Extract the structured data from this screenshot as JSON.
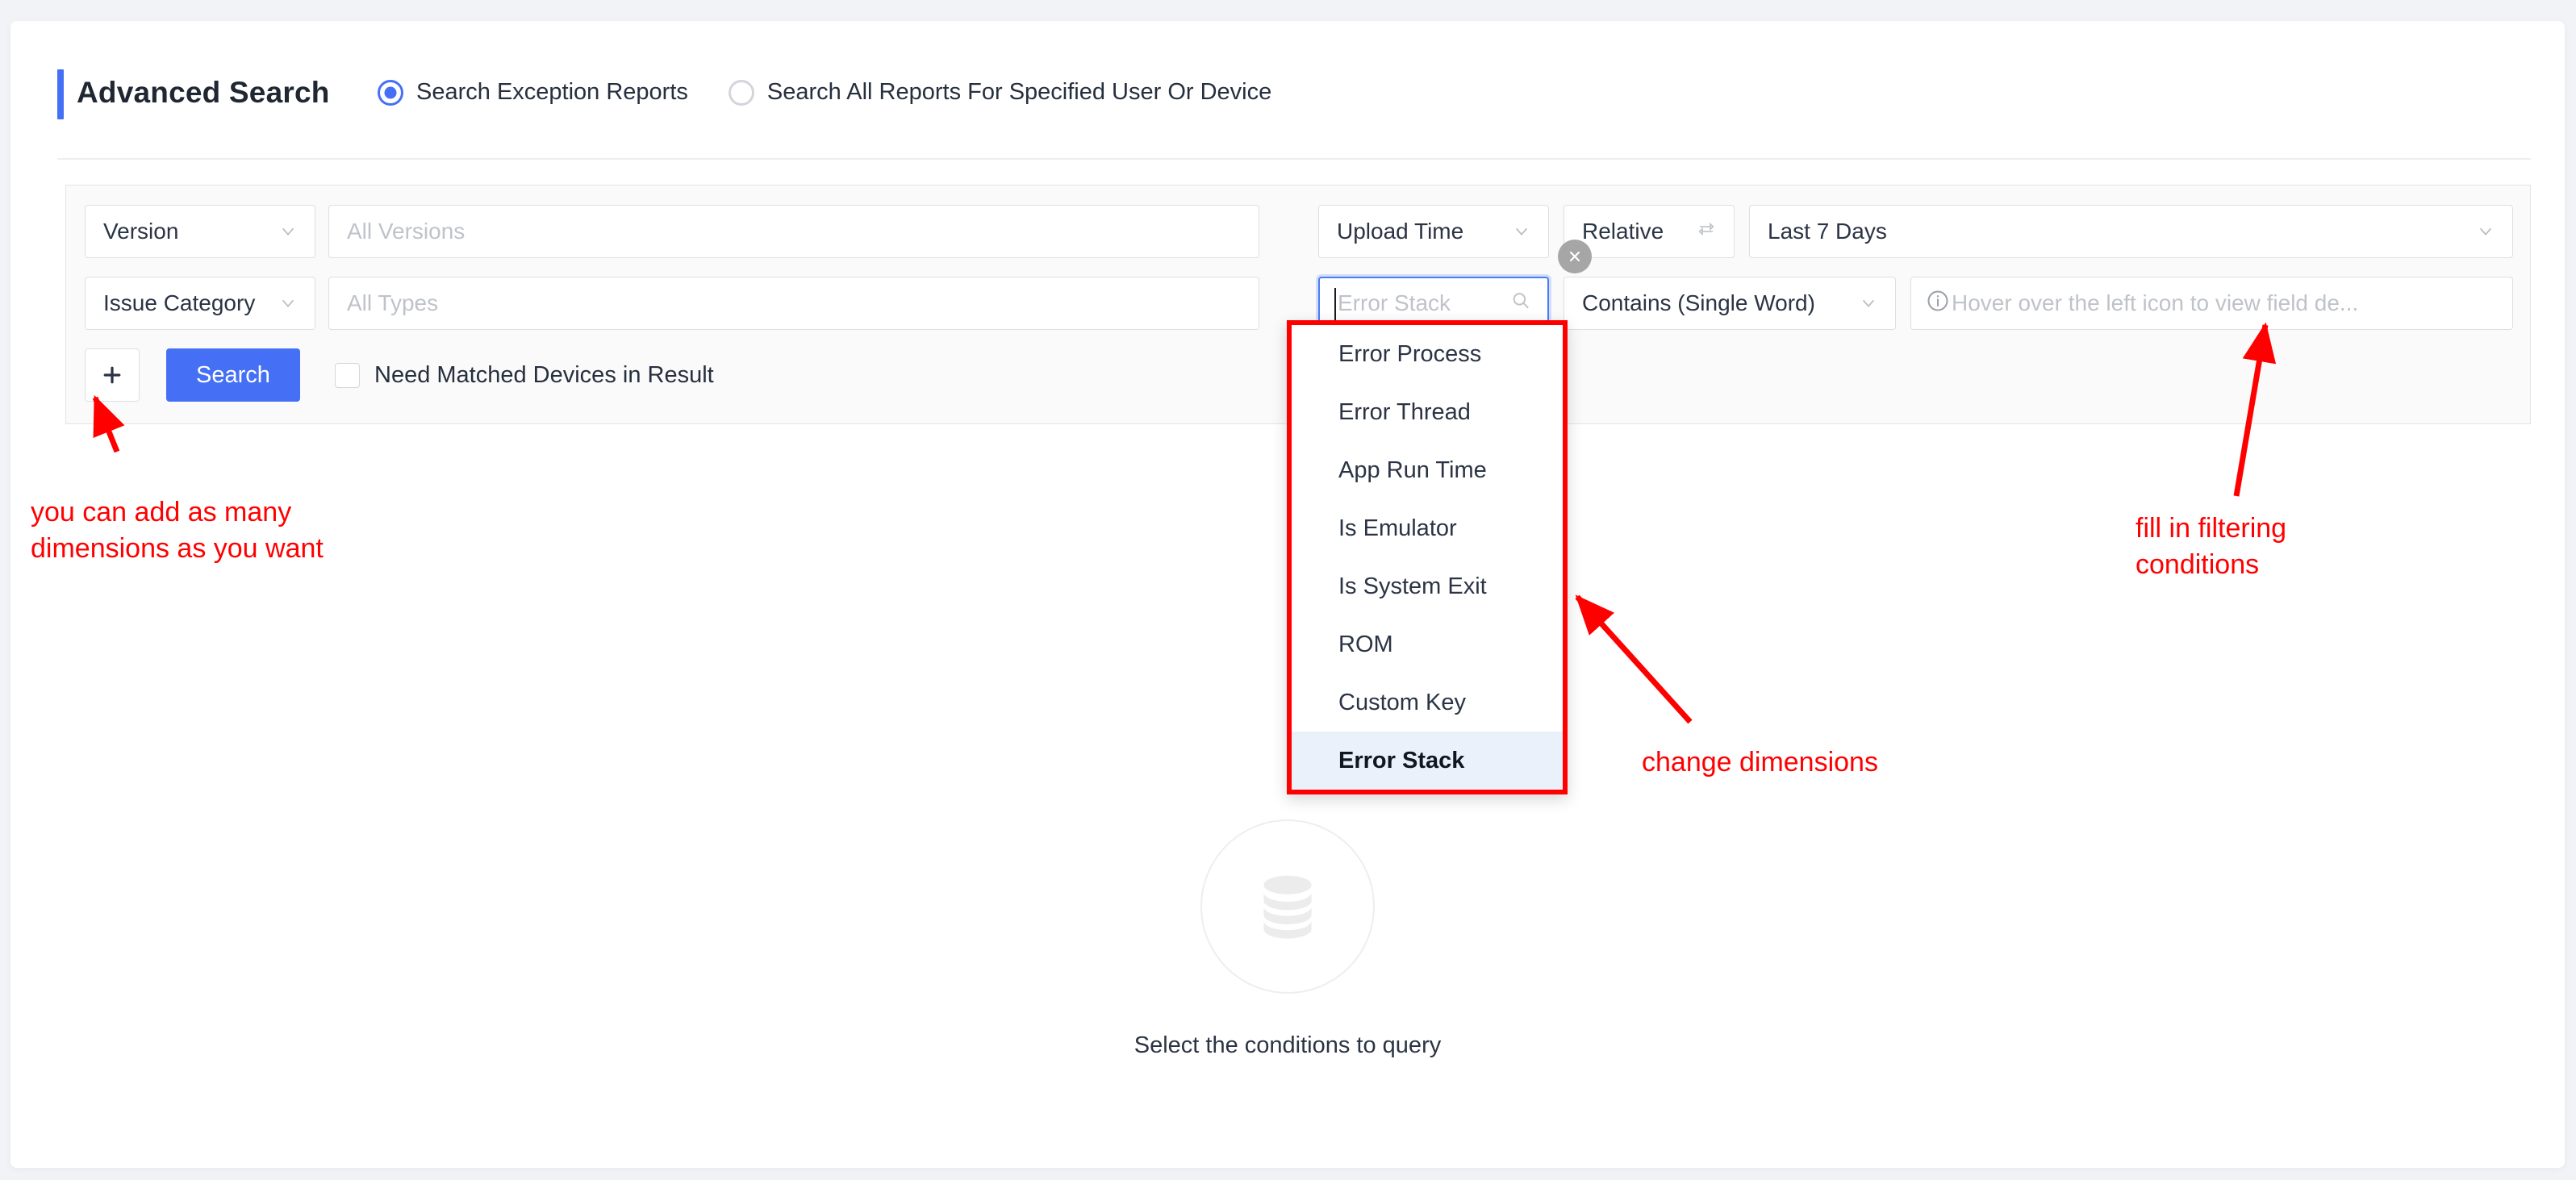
{
  "header": {
    "title": "Advanced Search",
    "radios": [
      {
        "label": "Search Exception Reports",
        "selected": true
      },
      {
        "label": "Search All Reports For Specified User Or Device",
        "selected": false
      }
    ]
  },
  "search_panel": {
    "fields": {
      "version_dim": "Version",
      "version_value_placeholder": "All Versions",
      "issue_category_dim": "Issue Category",
      "issue_category_value_placeholder": "All Types",
      "upload_time_dim": "Upload Time",
      "relative_label": "Relative",
      "time_range_value": "Last 7 Days",
      "error_stack_dim_placeholder": "Error Stack",
      "operator_value": "Contains (Single Word)",
      "condition_value_placeholder": "Hover over the left icon to view field de..."
    },
    "actions": {
      "add_label": "+",
      "search_label": "Search",
      "checkbox_label": "Need Matched Devices in Result",
      "checkbox_checked": false
    }
  },
  "dimension_dropdown": {
    "items": [
      {
        "label": "Error Process",
        "selected": false
      },
      {
        "label": "Error Thread",
        "selected": false
      },
      {
        "label": "App Run Time",
        "selected": false
      },
      {
        "label": "Is Emulator",
        "selected": false
      },
      {
        "label": "Is System Exit",
        "selected": false
      },
      {
        "label": "ROM",
        "selected": false
      },
      {
        "label": "Custom Key",
        "selected": false
      },
      {
        "label": "Error Stack",
        "selected": true
      }
    ]
  },
  "empty_state": {
    "icon": "database-icon",
    "message": "Select the conditions to query"
  },
  "annotations": [
    {
      "text": "you can add as many\ndimensions as you want"
    },
    {
      "text": "change dimensions"
    },
    {
      "text": "fill in filtering\nconditions"
    }
  ],
  "colors": {
    "accent": "#4570f5",
    "annotation": "#ff0000",
    "panel_bg": "#fafafa",
    "selected_item_bg": "#eaf1fb"
  }
}
